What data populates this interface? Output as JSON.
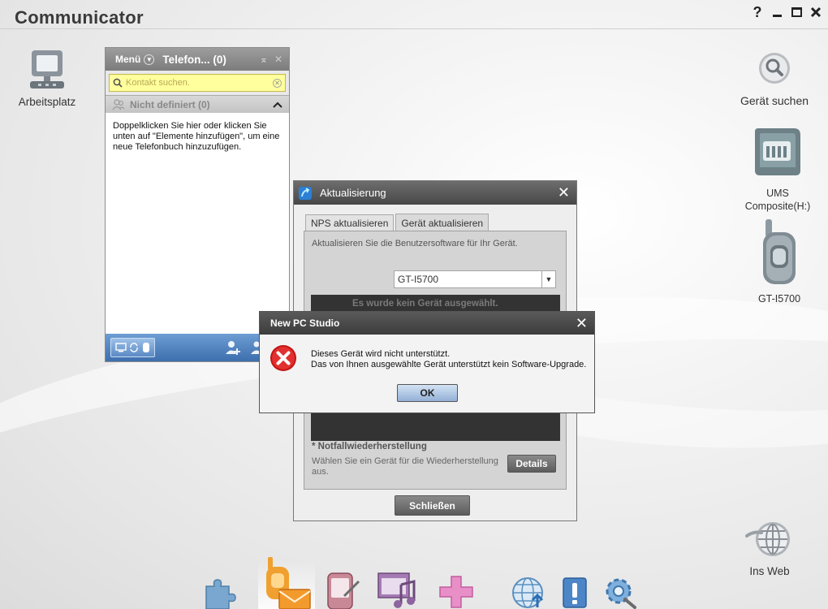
{
  "app": {
    "title": "Communicator"
  },
  "window_controls": {
    "help": "?"
  },
  "desktop": {
    "left_icons": [
      {
        "label": "Arbeitsplatz"
      }
    ],
    "right_icons": [
      {
        "label": "Gerät suchen"
      },
      {
        "label": "UMS Composite(H:)"
      },
      {
        "label": "GT-I5700"
      },
      {
        "label": "Ins Web"
      }
    ]
  },
  "phonebook": {
    "menu_label": "Menü",
    "title": "Telefon... (0)",
    "search_placeholder": "Kontakt suchen.",
    "group_label": "Nicht definiert (0)",
    "info_text": "Doppelklicken Sie hier oder klicken Sie unten auf \"Elemente hinzufügen\", um eine neue Telefonbuch hinzuzufügen."
  },
  "update_dialog": {
    "title": "Aktualisierung",
    "tabs": [
      {
        "label": "NPS aktualisieren"
      },
      {
        "label": "Gerät aktualisieren",
        "active": true
      }
    ],
    "description": "Aktualisieren Sie die Benutzersoftware für Ihr Gerät.",
    "device_select": "GT-I5700",
    "no_device_msg": "Es wurde kein Gerät ausgewählt.",
    "emergency_title": "* Notfallwiederherstellung",
    "emergency_desc": "Wählen Sie ein Gerät für die Wiederherstellung aus.",
    "details_button": "Details",
    "close_button": "Schließen"
  },
  "error_dialog": {
    "title": "New PC Studio",
    "line1": "Dieses Gerät wird nicht unterstützt.",
    "line2": "Das von Ihnen ausgewählte Gerät unterstützt kein Software-Upgrade.",
    "ok_button": "OK"
  },
  "colors": {
    "error_red": "#d32020",
    "accent_blue": "#4b7dbd",
    "search_yellow": "#ffff9d",
    "dock_orange": "#f0a030"
  }
}
